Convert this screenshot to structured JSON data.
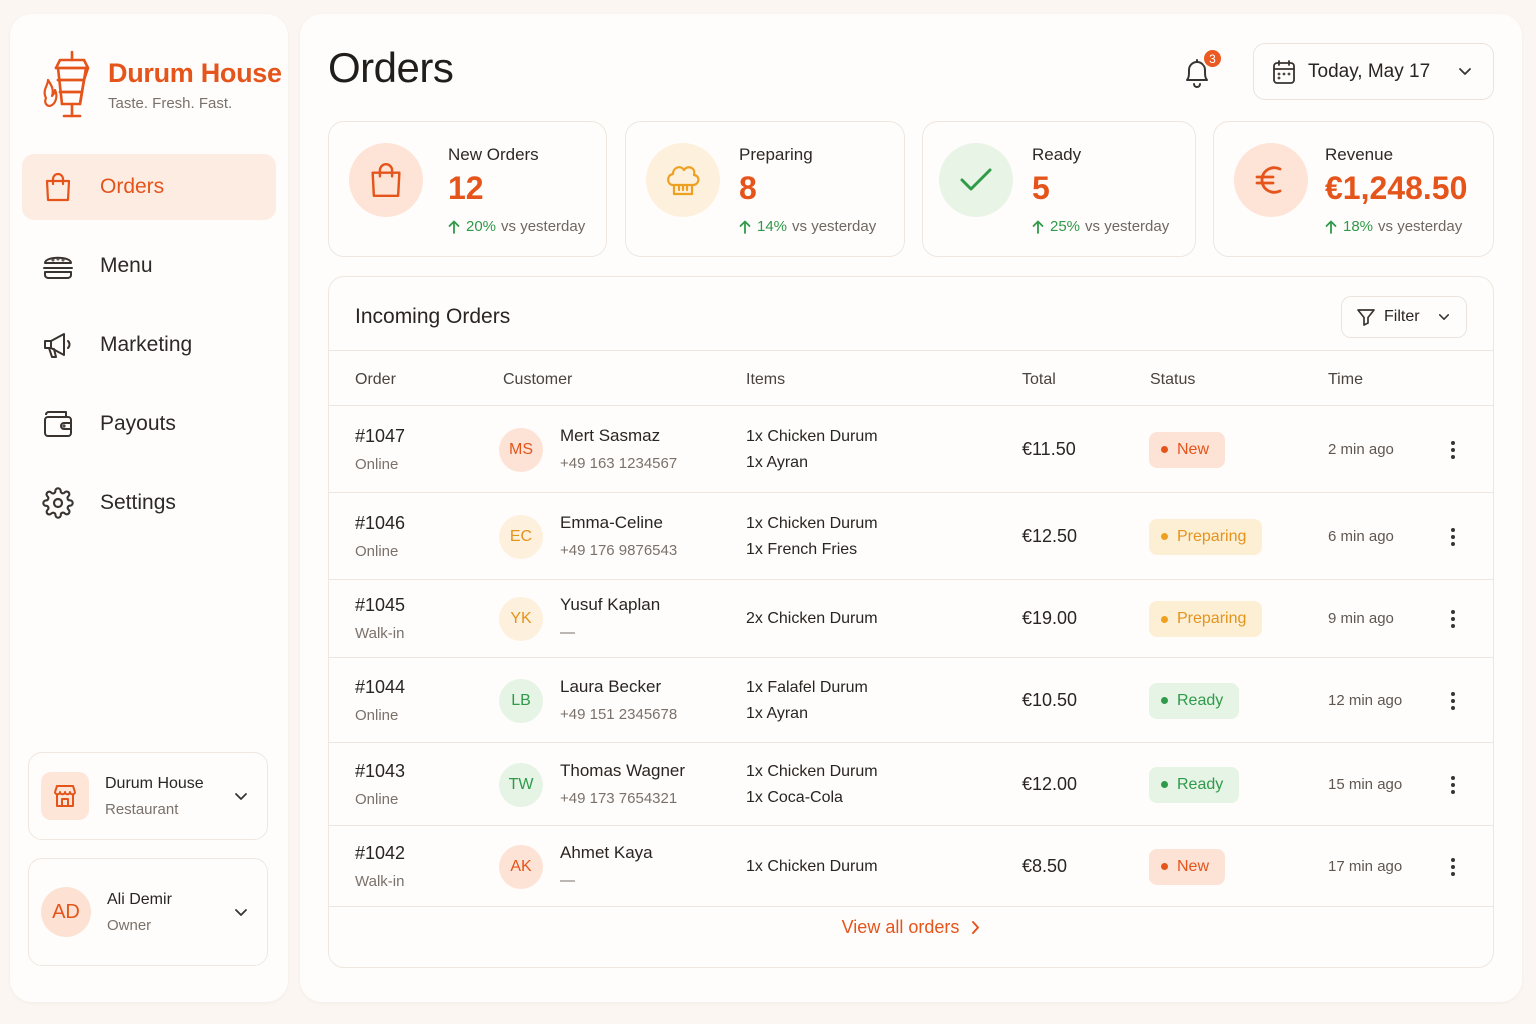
{
  "brand": {
    "name": "Durum House",
    "tagline": "Taste. Fresh. Fast."
  },
  "colors": {
    "accent": "#e4541b",
    "success": "#2f9a4a",
    "warning": "#e5931c"
  },
  "nav": [
    {
      "label": "Orders",
      "icon": "shopping-bag-icon",
      "active": true
    },
    {
      "label": "Menu",
      "icon": "burger-icon",
      "active": false
    },
    {
      "label": "Marketing",
      "icon": "megaphone-icon",
      "active": false
    },
    {
      "label": "Payouts",
      "icon": "wallet-icon",
      "active": false
    },
    {
      "label": "Settings",
      "icon": "gear-icon",
      "active": false
    }
  ],
  "shop": {
    "name": "Durum House",
    "type": "Restaurant"
  },
  "user": {
    "initials": "AD",
    "name": "Ali Demir",
    "role": "Owner"
  },
  "header": {
    "title": "Orders",
    "notifications": "3",
    "date_label": "Today, May 17"
  },
  "stats": [
    {
      "label": "New Orders",
      "value": "12",
      "trend": "20%",
      "trend_suffix": "vs yesterday",
      "icon": "shopping-bag-icon"
    },
    {
      "label": "Preparing",
      "value": "8",
      "trend": "14%",
      "trend_suffix": "vs yesterday",
      "icon": "chef-hat-icon"
    },
    {
      "label": "Ready",
      "value": "5",
      "trend": "25%",
      "trend_suffix": "vs yesterday",
      "icon": "check-icon"
    },
    {
      "label": "Revenue",
      "value": "€1,248.50",
      "trend": "18%",
      "trend_suffix": "vs yesterday",
      "icon": "euro-icon"
    }
  ],
  "orders": {
    "title": "Incoming Orders",
    "filter_label": "Filter",
    "columns": [
      "Order",
      "Customer",
      "Items",
      "Total",
      "Status",
      "Time"
    ],
    "rows": [
      {
        "id": "#1047",
        "source": "Online",
        "initials": "MS",
        "customer": "Mert Sasmaz",
        "phone": "+49 163 1234567",
        "items": [
          "1x Chicken Durum",
          "1x Ayran"
        ],
        "total": "€11.50",
        "status": "New",
        "time": "2 min ago"
      },
      {
        "id": "#1046",
        "source": "Online",
        "initials": "EC",
        "customer": "Emma-Celine",
        "phone": "+49 176 9876543",
        "items": [
          "1x Chicken Durum",
          "1x French Fries"
        ],
        "total": "€12.50",
        "status": "Preparing",
        "time": "6 min ago"
      },
      {
        "id": "#1045",
        "source": "Walk-in",
        "initials": "YK",
        "customer": "Yusuf Kaplan",
        "phone": "—",
        "items": [
          "2x Chicken Durum"
        ],
        "total": "€19.00",
        "status": "Preparing",
        "time": "9 min ago"
      },
      {
        "id": "#1044",
        "source": "Online",
        "initials": "LB",
        "customer": "Laura Becker",
        "phone": "+49 151 2345678",
        "items": [
          "1x Falafel Durum",
          "1x Ayran"
        ],
        "total": "€10.50",
        "status": "Ready",
        "time": "12 min ago"
      },
      {
        "id": "#1043",
        "source": "Online",
        "initials": "TW",
        "customer": "Thomas Wagner",
        "phone": "+49 173 7654321",
        "items": [
          "1x Chicken Durum",
          "1x Coca-Cola"
        ],
        "total": "€12.00",
        "status": "Ready",
        "time": "15 min ago"
      },
      {
        "id": "#1042",
        "source": "Walk-in",
        "initials": "AK",
        "customer": "Ahmet Kaya",
        "phone": "—",
        "items": [
          "1x Chicken Durum"
        ],
        "total": "€8.50",
        "status": "New",
        "time": "17 min ago"
      }
    ],
    "view_all_label": "View all orders"
  }
}
